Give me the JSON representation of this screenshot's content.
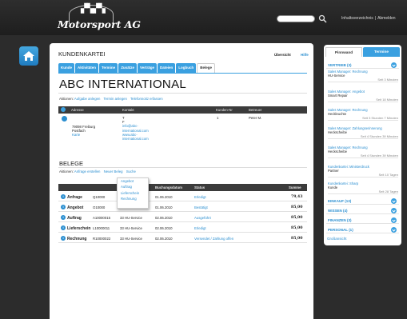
{
  "header": {
    "logo_text": "Motorsport AG",
    "search_placeholder": "",
    "links": [
      "Inhaltsverzeichnis",
      "|",
      "Abmelden"
    ]
  },
  "main": {
    "title": "KUNDENKARTEI",
    "top_links": {
      "overview": "Übersicht",
      "help": "Hilfe"
    },
    "tabs": [
      "Kunde",
      "Aktivitäten",
      "Termine",
      "Zusätze",
      "Verträge",
      "Dateien",
      "Logbuch",
      "Belege"
    ],
    "active_tab": "Belege",
    "company": "ABC INTERNATIONAL",
    "company_actions_label": "Aktionen:",
    "company_actions": [
      "Aufgabe anlegen",
      "Termin anlegen",
      "Telefonnotiz erfassen"
    ],
    "address_table": {
      "headers": [
        "Adresse",
        "Kontakt",
        "Kunden-Nr",
        "Betreuer"
      ],
      "address": [
        "79098 Freiburg",
        "Postfach"
      ],
      "address_link": "Karte",
      "contact": [
        "T",
        "F"
      ],
      "contact_links": [
        "info@abc-",
        "international.com",
        "www.abc-",
        "international.com"
      ],
      "customer_no": "1",
      "manager": "Peter M."
    },
    "belege": {
      "title": "BELEGE",
      "actions_label": "Aktionen:",
      "actions": [
        "Anfrage erstellen",
        "Neuer Beleg",
        "Suche"
      ],
      "dropdown": [
        "Angebot",
        "Auftrag",
        "Lieferschein",
        "Rechnung"
      ],
      "headers": [
        "",
        "",
        "Ihr Betreff",
        "Buchungsdatum",
        "Status",
        "Summe"
      ],
      "rows": [
        {
          "type": "Anfrage",
          "nr": "Q10000",
          "subject": "33 HU-Service",
          "date": "01.06.2010",
          "status": "Erledigt",
          "sum": "79,43"
        },
        {
          "type": "Angebot",
          "nr": "O10000",
          "subject": "33 HU-Service",
          "date": "01.06.2010",
          "status": "Bestätigt",
          "sum": "85,00"
        },
        {
          "type": "Auftrag",
          "nr": "A10000015",
          "subject": "33 HU-Service",
          "date": "02.06.2010",
          "status": "Ausgeführt",
          "sum": "85,00"
        },
        {
          "type": "Lieferschein",
          "nr": "L10000011",
          "subject": "33 HU-Service",
          "date": "02.06.2010",
          "status": "Erledigt",
          "sum": "85,00"
        },
        {
          "type": "Rechnung",
          "nr": "R10000022",
          "subject": "33 HU-Service",
          "date": "02.06.2010",
          "status": "Versendet / Zahlung offen",
          "sum": "85,00"
        }
      ]
    }
  },
  "sidebar": {
    "tabs": [
      "Pinnwand",
      "Termine"
    ],
    "sections": [
      {
        "label": "VERTRIEB",
        "count": "(3)"
      },
      {
        "label": "EINKAUF",
        "count": "(13)"
      },
      {
        "label": "WISSEN",
        "count": "(4)"
      },
      {
        "label": "FINANZEN",
        "count": "(3)"
      },
      {
        "label": "PERSONAL",
        "count": "(1)"
      }
    ],
    "notes": [
      {
        "title": "Sales Manager: Rechnung",
        "sub": "HU-Service",
        "date": "Seit 3 Minuten"
      },
      {
        "title": "Sales Manager: Angebot",
        "sub": "Smart Repair",
        "date": "Seit 18 Minuten"
      },
      {
        "title": "Sales Manager: Rechnung",
        "sub": "Heckleuchte",
        "date": "Seit 3 Stunden 7 Minuten"
      },
      {
        "title": "Sales Manager: Zahlungserinnerung",
        "sub": "Heckscheibe",
        "date": "Seit 4 Stunden 39 Minuten"
      },
      {
        "title": "Sales Manager: Rechnung",
        "sub": "Heckscheibe",
        "date": "Seit 4 Stunden 39 Minuten"
      },
      {
        "title": "Kundenkartei: Ministerdruck",
        "sub": "Partner",
        "date": "Seit 10 Tagen"
      },
      {
        "title": "Kundenkartei: Sharp",
        "sub": "Kunde",
        "date": "Seit 28 Tagen"
      }
    ],
    "footer": "Großansicht"
  },
  "colors": {
    "accent": "#3aa0e0",
    "dark": "#2c2c2c"
  }
}
